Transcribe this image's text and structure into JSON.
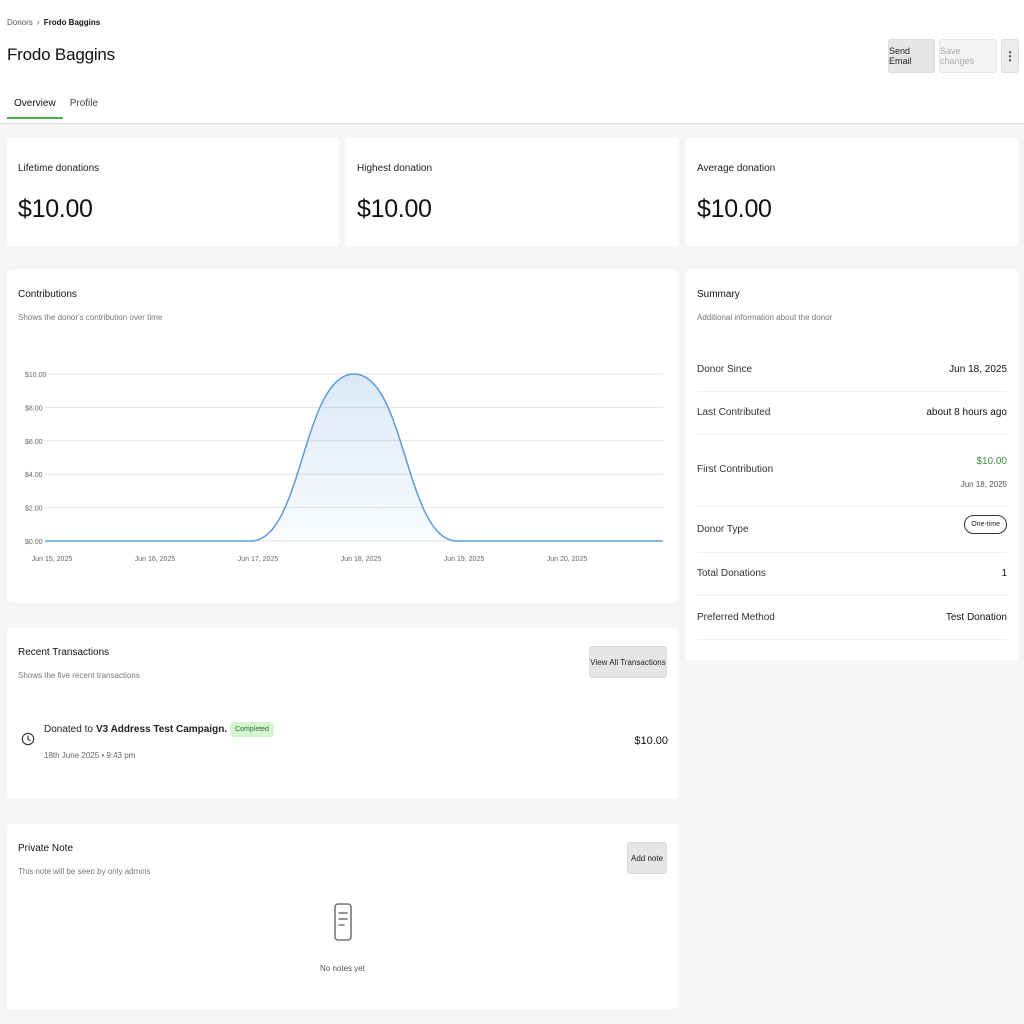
{
  "breadcrumb": {
    "parent": "Donors",
    "separator": "›",
    "current": "Frodo Baggins"
  },
  "header": {
    "title": "Frodo Baggins",
    "send_email": "Send Email",
    "save_changes": "Save changes",
    "more": "⋮"
  },
  "tabs": [
    {
      "label": "Overview",
      "active": true
    },
    {
      "label": "Profile",
      "active": false
    }
  ],
  "stats": [
    {
      "label": "Lifetime donations",
      "value": "$10.00"
    },
    {
      "label": "Highest donation",
      "value": "$10.00"
    },
    {
      "label": "Average donation",
      "value": "$10.00"
    }
  ],
  "contributions": {
    "title": "Contributions",
    "subtitle": "Shows the donor's contribution over time"
  },
  "chart_data": {
    "type": "area",
    "x": [
      "Jun 15, 2025",
      "Jun 16, 2025",
      "Jun 17, 2025",
      "Jun 18, 2025",
      "Jun 19, 2025",
      "Jun 20, 2025"
    ],
    "y_ticks": [
      "$0.00",
      "$2.00",
      "$4.00",
      "$6.00",
      "$8.00",
      "$10.00"
    ],
    "points": [
      {
        "x": "Jun 15, 2025",
        "y": 0
      },
      {
        "x": "Jun 16, 2025",
        "y": 0
      },
      {
        "x": "Jun 17, 2025",
        "y": 0
      },
      {
        "x": "Jun 18, 2025",
        "y": 10
      },
      {
        "x": "Jun 19, 2025",
        "y": 0
      },
      {
        "x": "Jun 20, 2025",
        "y": 0
      },
      {
        "x": "Jun 21, 2025",
        "y": 0
      }
    ],
    "ylim": [
      0,
      10
    ],
    "grid": true,
    "color": "#5b9bdc"
  },
  "summary": {
    "title": "Summary",
    "subtitle": "Additional information about the donor",
    "rows": [
      {
        "key": "Donor Since",
        "value": "Jun 18, 2025"
      },
      {
        "key": "Last Contributed",
        "value": "about 8 hours ago"
      },
      {
        "key": "First Contribution",
        "value": "$10.00",
        "sub": "Jun 18, 2025"
      },
      {
        "key": "Donor Type",
        "value": "One-time"
      },
      {
        "key": "Total Donations",
        "value": "1"
      },
      {
        "key": "Preferred Method",
        "value": "Test Donation"
      }
    ],
    "accent": "#3f8f3a"
  },
  "transactions": {
    "title": "Recent Transactions",
    "subtitle": "Shows the five recent transactions",
    "view_all": "View All Transactions",
    "items": [
      {
        "prefix": "Donated to",
        "campaign": "V3 Address Test Campaign.",
        "status": "Completed",
        "date": "18th June 2025 • 9:43 pm",
        "amount": "$10.00",
        "icon": "clock-icon"
      }
    ]
  },
  "note": {
    "title": "Private Note",
    "subtitle": "This note will be seen by only admins",
    "add": "Add note",
    "empty": "No notes yet",
    "icon": "note-icon"
  }
}
